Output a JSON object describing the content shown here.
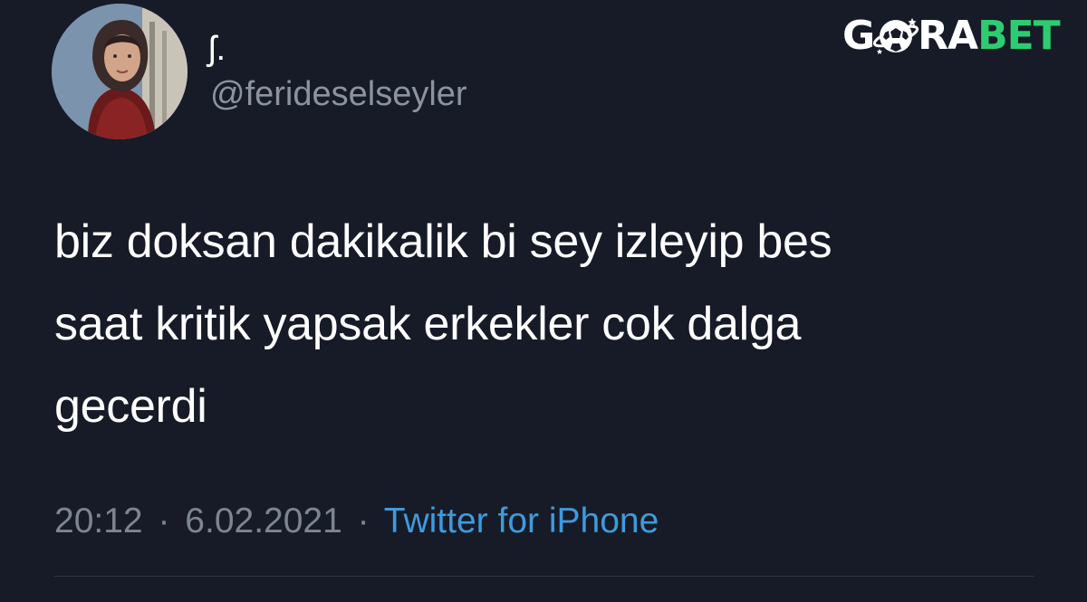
{
  "user": {
    "display_name": "ʃ.",
    "handle": "@ferideselseyler",
    "avatar": "profile-photo"
  },
  "tweet": {
    "lines": [
      "biz doksan dakikalik bi sey izleyip bes",
      "saat kritik yapsak erkekler cok dalga",
      "gecerdi"
    ],
    "time": "20:12",
    "date": "6.02.2021",
    "separator": "·",
    "source": "Twitter for iPhone"
  },
  "watermark": {
    "part1": "G",
    "part2": "RA",
    "part3": "BET",
    "icon": "soccer-ball-icon"
  },
  "colors": {
    "background": "#161b27",
    "text": "#ffffff",
    "muted": "#7d8590",
    "link": "#3e9bdc",
    "brand_green": "#2ecc71"
  }
}
